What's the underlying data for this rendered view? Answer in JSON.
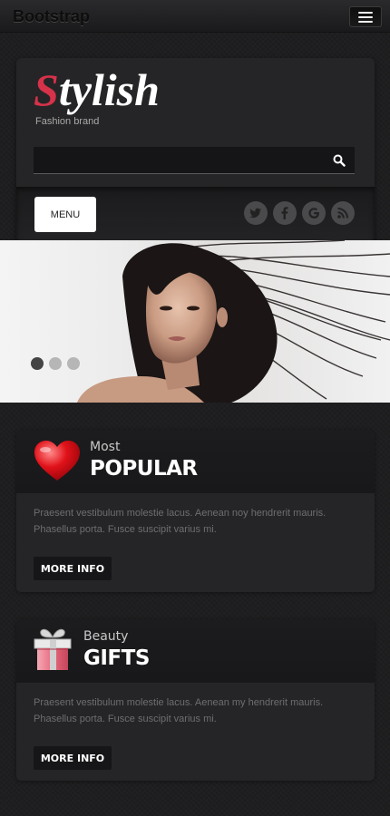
{
  "navbar": {
    "brand": "Bootstrap",
    "toggle_icon": "hamburger-icon"
  },
  "header": {
    "logo_first_letter": "S",
    "logo_rest": "tylish",
    "tagline": "Fashion brand",
    "search": {
      "value": "",
      "placeholder": "",
      "icon": "search-icon"
    },
    "menu_label": "MENU",
    "social": [
      "twitter-icon",
      "facebook-icon",
      "google-icon",
      "rss-icon"
    ]
  },
  "slider": {
    "dots_total": 3,
    "active_dot": 1
  },
  "cards": [
    {
      "icon": "heart-icon",
      "small_title": "Most",
      "big_title": "POPULAR",
      "text": "Praesent vestibulum molestie lacus. Aenean noy hendrerit mauris. Phasellus porta. Fusce suscipit varius mi.",
      "button": "MORE INFO"
    },
    {
      "icon": "gift-icon",
      "small_title": "Beauty",
      "big_title": "GIFTS",
      "text": "Praesent vestibulum molestie lacus. Aenean my hendrerit mauris. Phasellus porta. Fusce suscipit varius mi.",
      "button": "MORE INFO"
    }
  ],
  "colors": {
    "accent": "#d6324a",
    "background": "#1e1e20",
    "panel": "#252527"
  }
}
